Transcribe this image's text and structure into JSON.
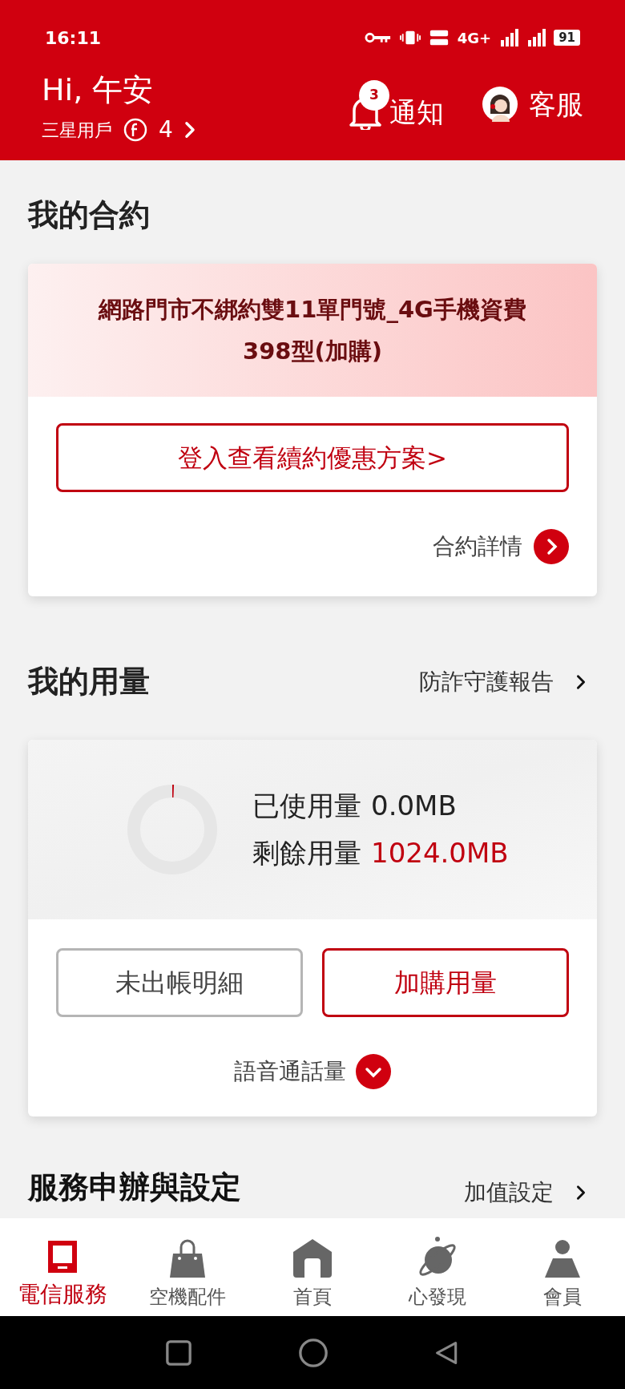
{
  "status_bar": {
    "time": "16:11",
    "network": "4G+",
    "battery": "91"
  },
  "header": {
    "greeting": "Hi, 午安",
    "user_type": "三星用戶",
    "points": "4",
    "notifications": {
      "label": "通知",
      "badge": "3"
    },
    "support": {
      "label": "客服"
    }
  },
  "contract": {
    "title": "我的合約",
    "plan": "網路門市不綁約雙11單門號_4G手機資費398型(加購)",
    "renew_button": "登入查看續約優惠方案>",
    "details_link": "合約詳情"
  },
  "usage": {
    "title": "我的用量",
    "fraud_report_link": "防詐守護報告",
    "level": 0,
    "used_label": "已使用量",
    "used_value": "0.0MB",
    "remaining_label": "剩餘用量",
    "remaining_value": "1024.0MB",
    "buttons": [
      {
        "label": "未出帳明細",
        "kind": "outline"
      },
      {
        "label": "加購用量",
        "kind": "primary"
      }
    ],
    "voice_toggle": "語音通話量"
  },
  "services": {
    "title": "服務申辦與設定",
    "link": "加值設定"
  },
  "bottom_nav": [
    {
      "label": "電信服務",
      "selected": true
    },
    {
      "label": "空機配件",
      "selected": false
    },
    {
      "label": "首頁",
      "selected": false
    },
    {
      "label": "心發現",
      "selected": false
    },
    {
      "label": "會員",
      "selected": false
    }
  ]
}
